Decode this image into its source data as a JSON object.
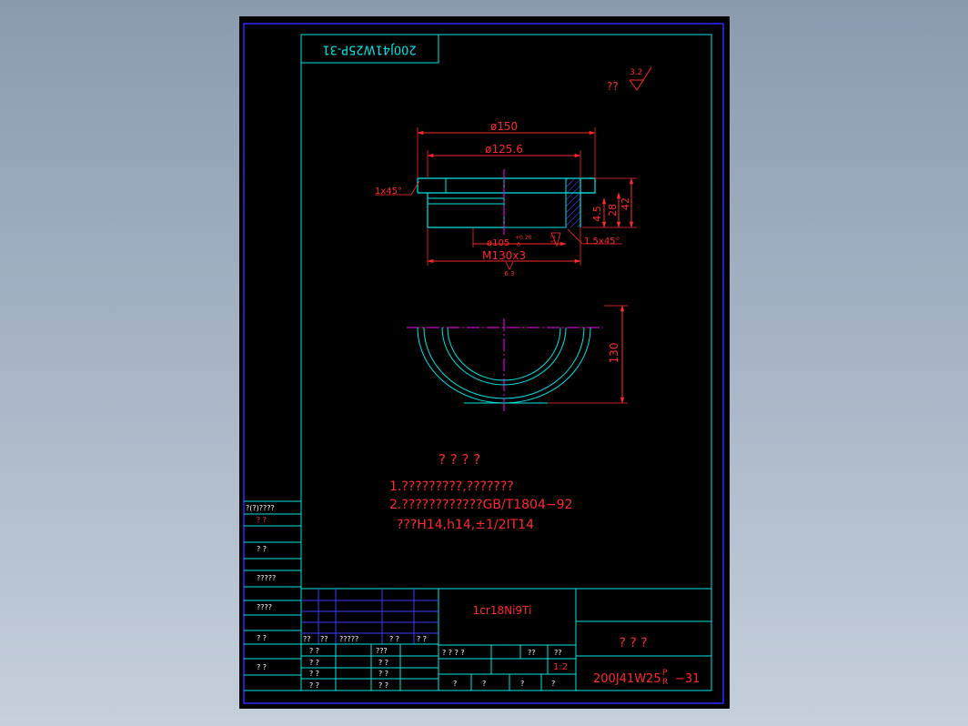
{
  "colors": {
    "background": "#000000",
    "outer_frame": "#2222ff",
    "cyan": "#00e5e5",
    "red": "#ff2a2a",
    "magenta": "#ff00ff",
    "blue": "#3a3aff",
    "white": "#ffffff",
    "hatch": "#4a4aff"
  },
  "title_tag": "200J41W25P-31",
  "roughness": {
    "label": "??",
    "value": "3.2"
  },
  "dimensions": {
    "phi150": "ø150",
    "phi125_6": "ø125.6",
    "chamfer_left": "1x45°",
    "phi105": "ø105",
    "phi105_tol": "+0.20",
    "phi105_tol_low": "0",
    "chamfer_right": "1.5x45°",
    "thread": "M130x3",
    "thread_rough": "6.3",
    "h4_5": "4.5",
    "h28": "28",
    "h42": "42",
    "v130": "130",
    "small_rough": "3.2"
  },
  "notes": {
    "title": "? ? ? ?",
    "line1": "1.?????????,???????",
    "line2": "2.????????????GB/T1804−92",
    "line3": "???H14,h14,±1/2IT14"
  },
  "left_strip": {
    "r1": "?(?)????",
    "r2": "?    ?",
    "r3": "?    ?",
    "r4": "?????",
    "r5": "????",
    "r6": "?    ?",
    "r7": "?    ?"
  },
  "title_block": {
    "material": "1cr18Ni9Ti",
    "part_name": "? ? ?",
    "drawing_no": "200J41W25",
    "drawing_no_sup": "P",
    "drawing_no_sub": "R",
    "drawing_no_suffix": "−31",
    "scale": "1:2",
    "hdr_a": "??",
    "hdr_b": "??",
    "hdr_c": "?????",
    "hdr_d": "? ?",
    "hdr_e": "? ?",
    "row1_a": "? ?",
    "row1_b": "???",
    "row2_a": "? ?",
    "row2_b": "? ?",
    "row3_a": "? ?",
    "row3_b": "? ?",
    "row4_a": "? ?",
    "row4_b": "? ?",
    "stage": "? ? ? ?",
    "weight": "??",
    "scale_hdr": "??",
    "sheet1": "?",
    "sheet2": "?",
    "sheet3": "?",
    "sheet4": "?"
  }
}
